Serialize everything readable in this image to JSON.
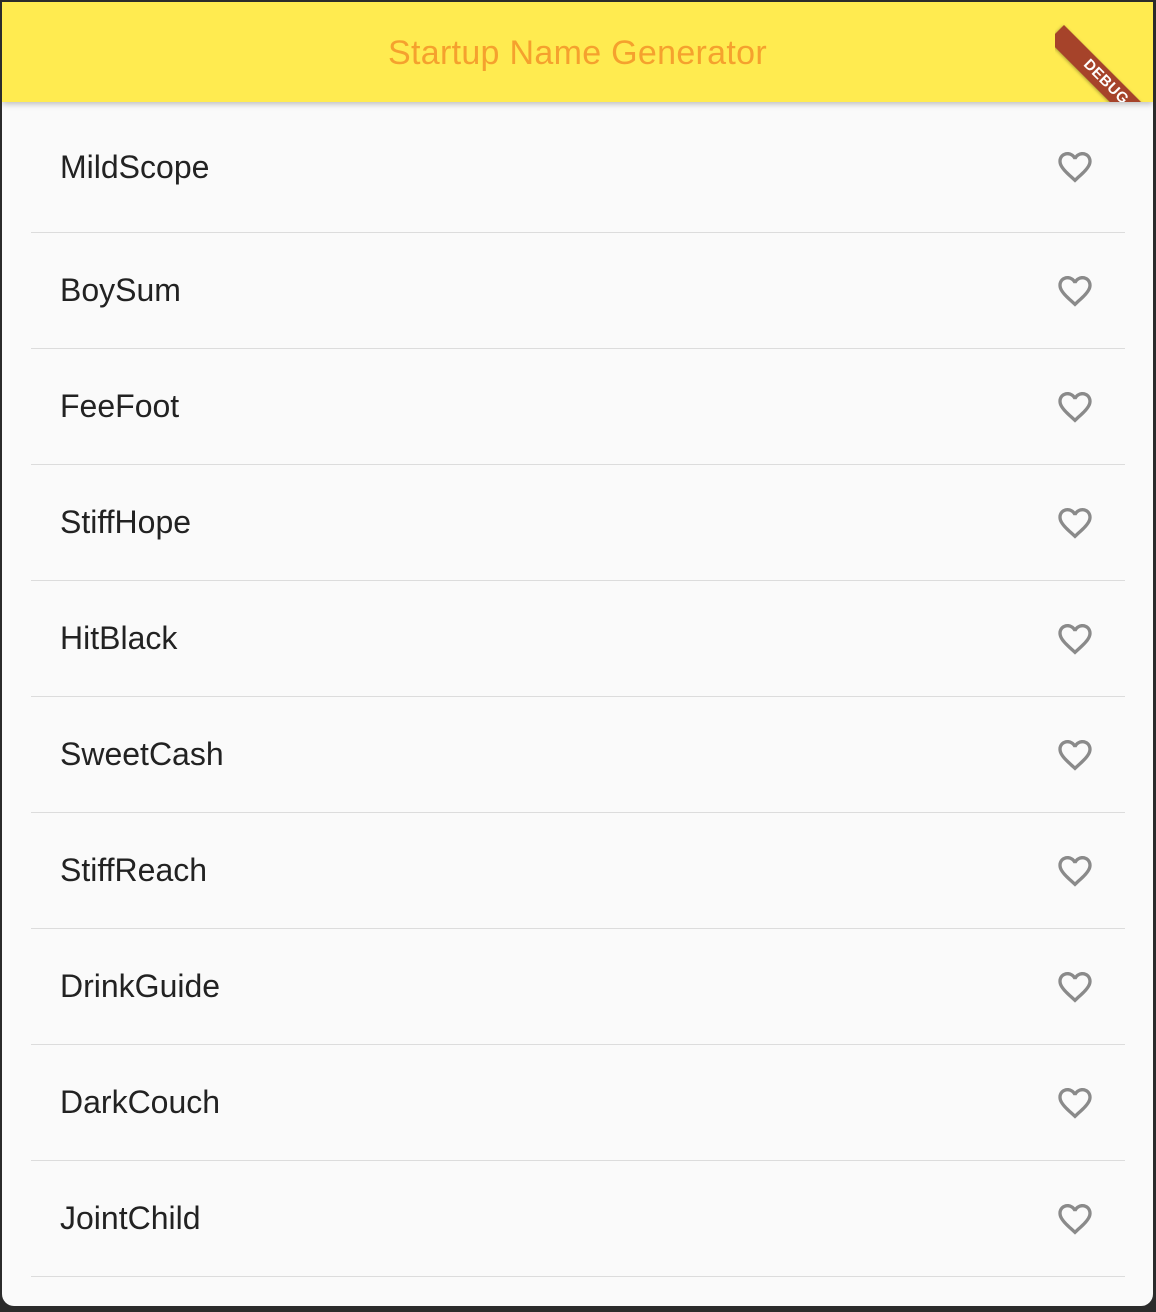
{
  "appbar": {
    "title": "Startup Name Generator",
    "background_color": "#ffeb50",
    "title_color": "#f5a12e"
  },
  "debug_banner": {
    "label": "DEBUG",
    "color": "#a6432a"
  },
  "list": {
    "items": [
      {
        "label": "MildScope",
        "icon": "heart-outline-icon",
        "favorited": false
      },
      {
        "label": "BoySum",
        "icon": "heart-outline-icon",
        "favorited": false
      },
      {
        "label": "FeeFoot",
        "icon": "heart-outline-icon",
        "favorited": false
      },
      {
        "label": "StiffHope",
        "icon": "heart-outline-icon",
        "favorited": false
      },
      {
        "label": "HitBlack",
        "icon": "heart-outline-icon",
        "favorited": false
      },
      {
        "label": "SweetCash",
        "icon": "heart-outline-icon",
        "favorited": false
      },
      {
        "label": "StiffReach",
        "icon": "heart-outline-icon",
        "favorited": false
      },
      {
        "label": "DrinkGuide",
        "icon": "heart-outline-icon",
        "favorited": false
      },
      {
        "label": "DarkCouch",
        "icon": "heart-outline-icon",
        "favorited": false
      },
      {
        "label": "JointChild",
        "icon": "heart-outline-icon",
        "favorited": false
      }
    ]
  }
}
